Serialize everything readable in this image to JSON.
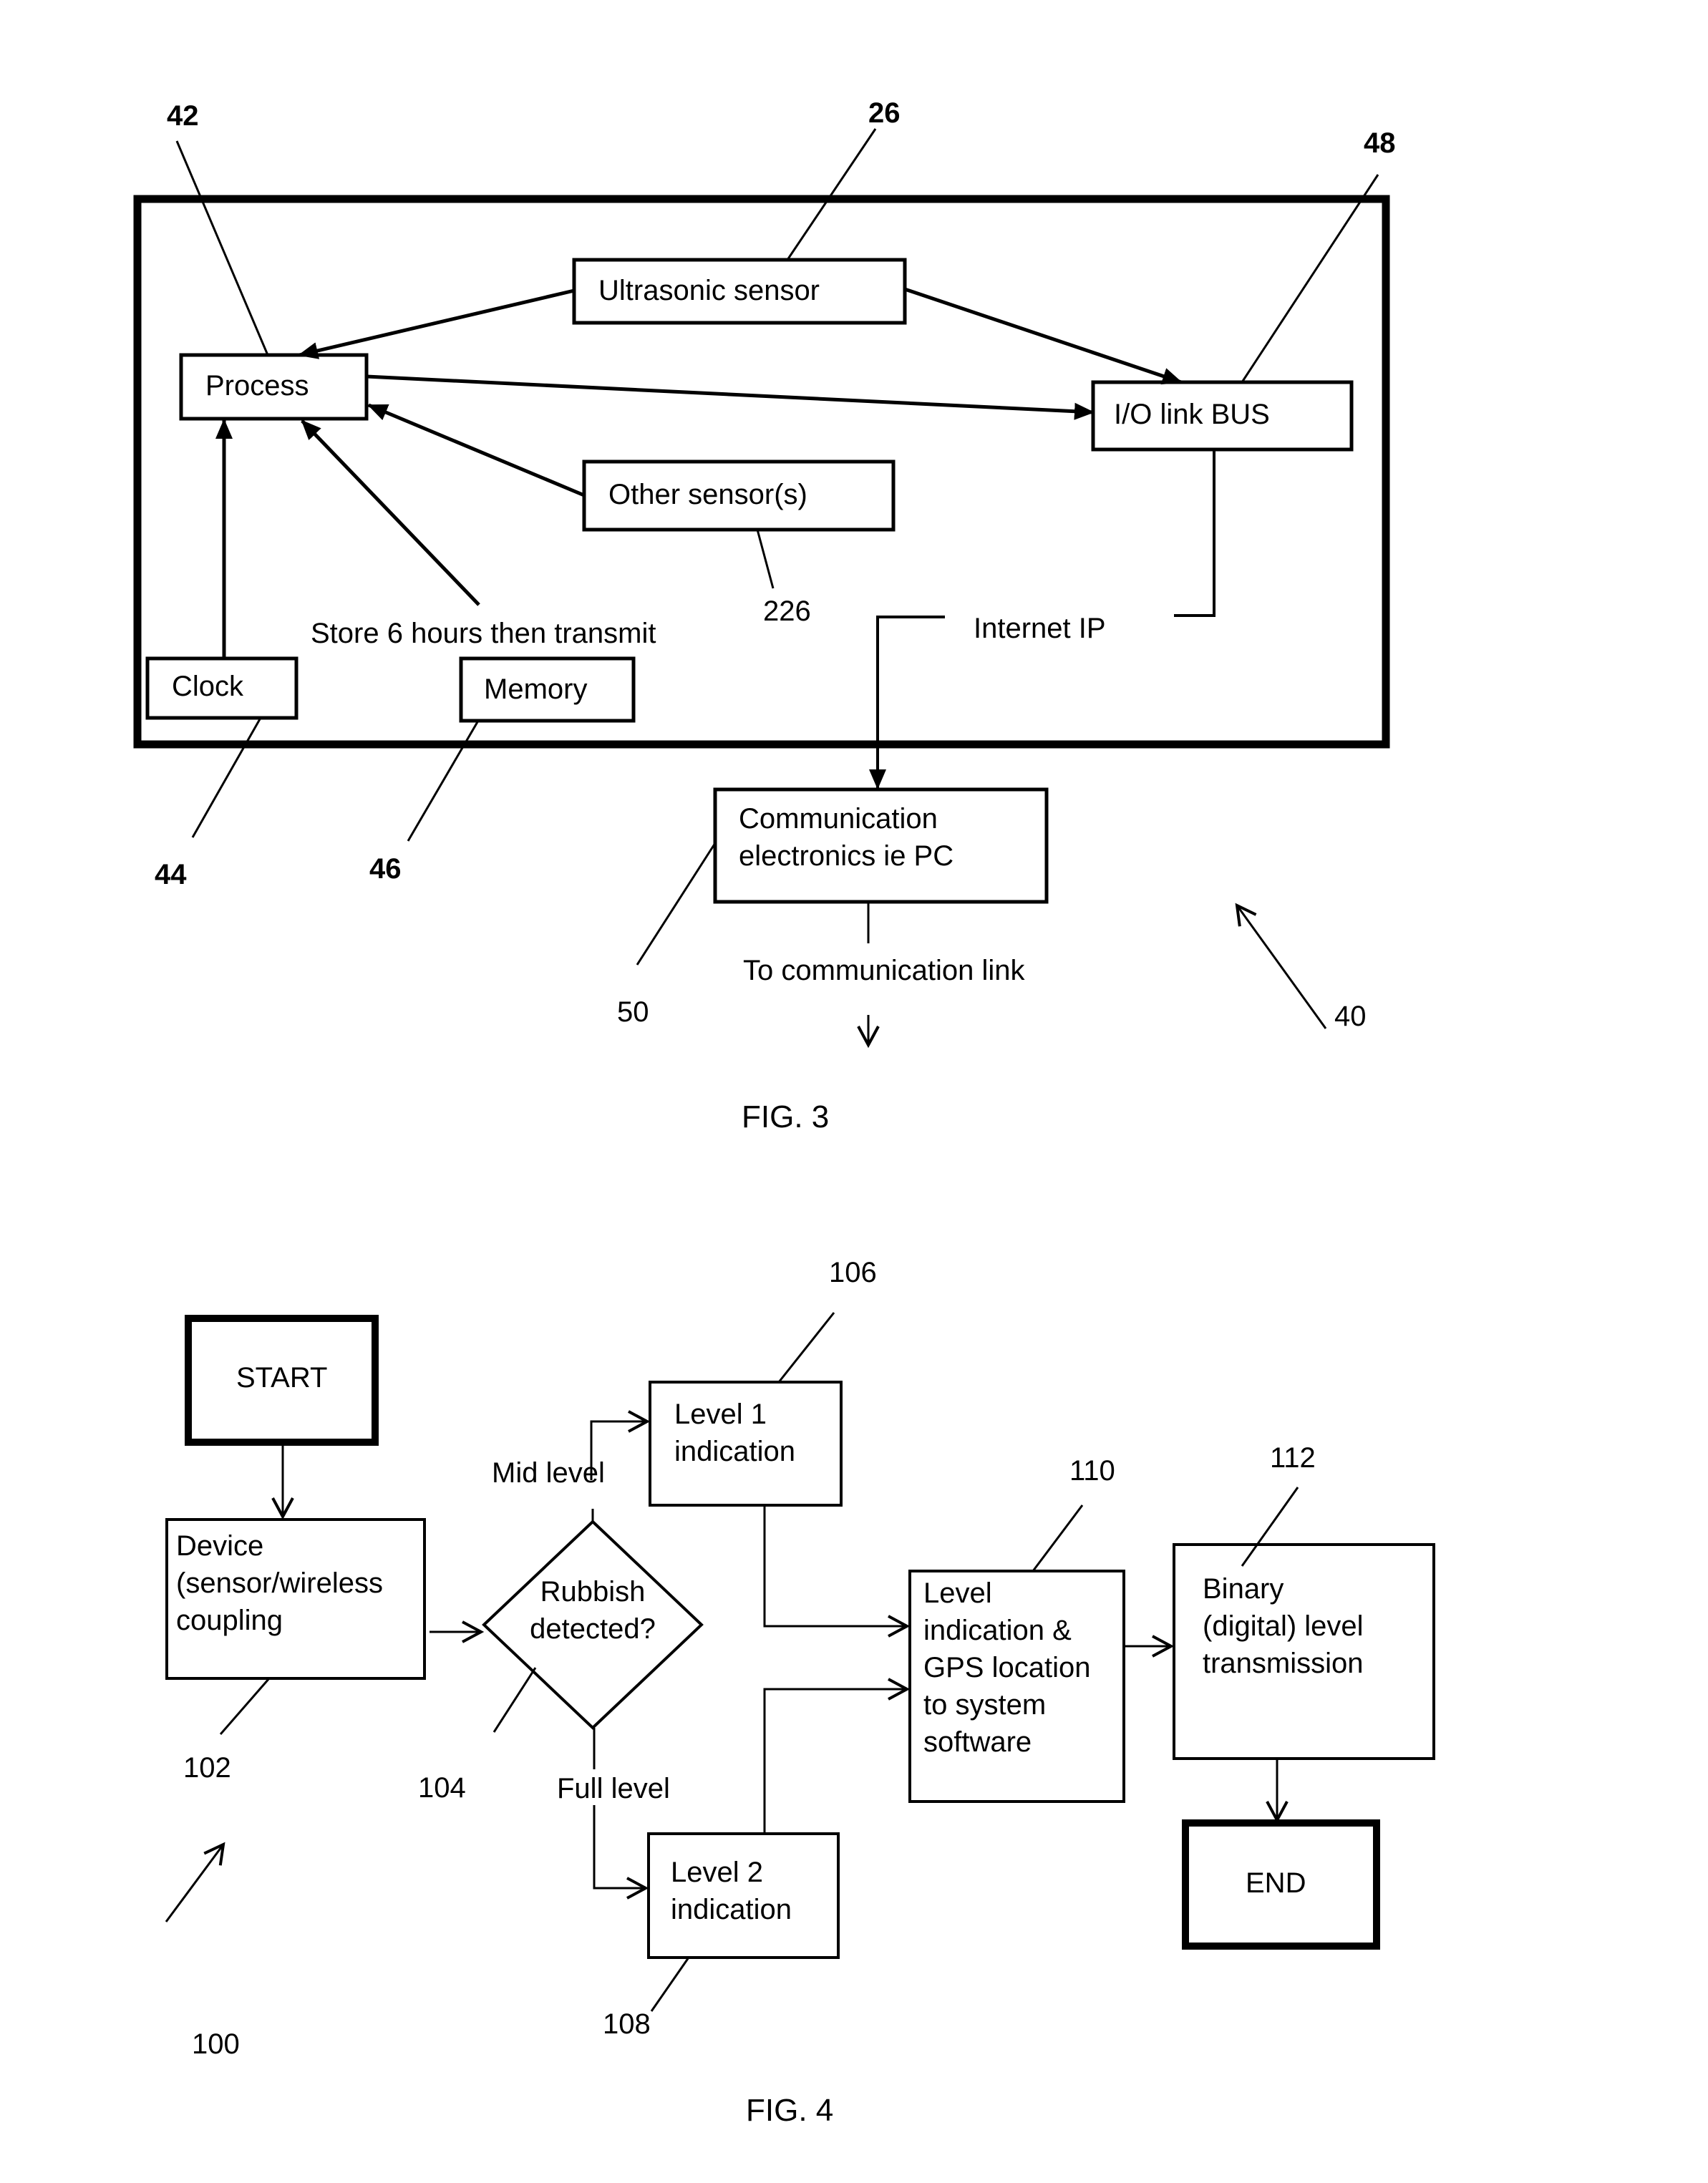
{
  "fig3": {
    "caption": "FIG. 3",
    "assembly_ref": "40",
    "blocks": {
      "process": {
        "label": "Process",
        "ref": "42"
      },
      "ultrasonic": {
        "label": "Ultrasonic sensor",
        "ref": "26"
      },
      "io_bus": {
        "label": "I/O link BUS",
        "ref": "48"
      },
      "other_sensors": {
        "label": "Other sensor(s)",
        "ref": "226"
      },
      "clock": {
        "label": "Clock",
        "ref": "44"
      },
      "memory": {
        "label": "Memory",
        "ref": "46"
      },
      "communication": {
        "line1": "Communication",
        "line2": "electronics ie PC",
        "ref": "50"
      }
    },
    "annotations": {
      "store": "Store 6 hours then transmit",
      "internet": "Internet IP",
      "to_link": "To communication link"
    }
  },
  "fig4": {
    "caption": "FIG. 4",
    "flowchart_ref": "100",
    "start": {
      "label": "START"
    },
    "device": {
      "line1": "Device",
      "line2": "(sensor/wireless",
      "line3": "coupling",
      "ref": "102"
    },
    "decision": {
      "line1": "Rubbish",
      "line2": "detected?",
      "ref": "104"
    },
    "branch_mid": "Mid level",
    "branch_full": "Full level",
    "level1": {
      "line1": "Level 1",
      "line2": "indication",
      "ref": "106"
    },
    "level2": {
      "line1": "Level 2",
      "line2": "indication",
      "ref": "108"
    },
    "level_gps": {
      "line1": "Level",
      "line2": "indication &",
      "line3": "GPS location",
      "line4": "to system",
      "line5": "software",
      "ref": "110"
    },
    "binary": {
      "line1": "Binary",
      "line2": "(digital) level",
      "line3": "transmission",
      "ref": "112"
    },
    "end": {
      "label": "END"
    }
  }
}
